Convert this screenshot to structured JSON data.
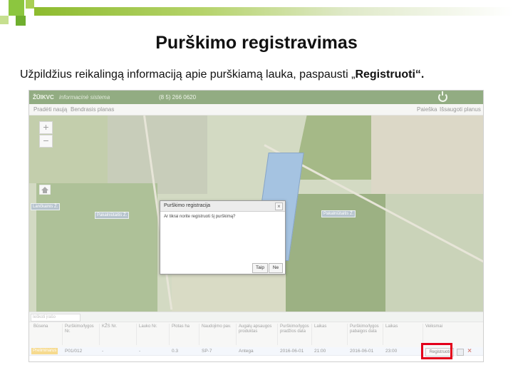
{
  "slide": {
    "title": "Purškimo registravimas",
    "subtitle_before": "Užpildžius reikalingą informaciją apie purškiamą lauka, paspausti „",
    "subtitle_bold": "Registruoti“.",
    "accent_color": "#8cc63f",
    "highlight_color": "#e3001b"
  },
  "app": {
    "logo": "ŽŪIKVC",
    "subname": "informacinė sistema",
    "phone": "(8 5) 266 0620",
    "toolbar": {
      "left_items": [
        "Pradėti naują",
        "Bendrasis planas"
      ],
      "right_items": [
        "Paieška",
        "Išsaugoti planus"
      ]
    },
    "map": {
      "zoom_in": "+",
      "zoom_out": "−",
      "labels": [
        "Lančkainis Ž.",
        "Pakalniūtaitis Ž.",
        "Pakalniūtaitis Ž."
      ]
    },
    "dialog": {
      "title": "Purškimo registracija",
      "close": "×",
      "message": "Ar tikrai norite registruoti šį purškimą?",
      "yes_label": "Taip",
      "no_label": "Ne"
    },
    "search": {
      "placeholder": "Ieškoti įrašo"
    },
    "grid": {
      "headers": [
        "Būsena",
        "Purškimo/lygos Nr.",
        "KŽS Nr.",
        "Lauko Nr.",
        "Plotas ha",
        "Naudojimo pav.",
        "Augalų apsaugos produktas",
        "Purškimo/lygos pradžios data",
        "Laikas",
        "Purškimo/lygos pabaigos data",
        "Laikas",
        "Veiksmai"
      ],
      "row": {
        "status": "Preliminarus",
        "number": "P01/012",
        "kzs": "-",
        "field": "-",
        "area": "0.3",
        "usage": "SP-7",
        "product": "Antega",
        "start_date": "2016-06-01",
        "start_time": "21:00",
        "end_date": "2016-06-01",
        "end_time": "23:00",
        "register_label": "Registruoti"
      }
    }
  }
}
